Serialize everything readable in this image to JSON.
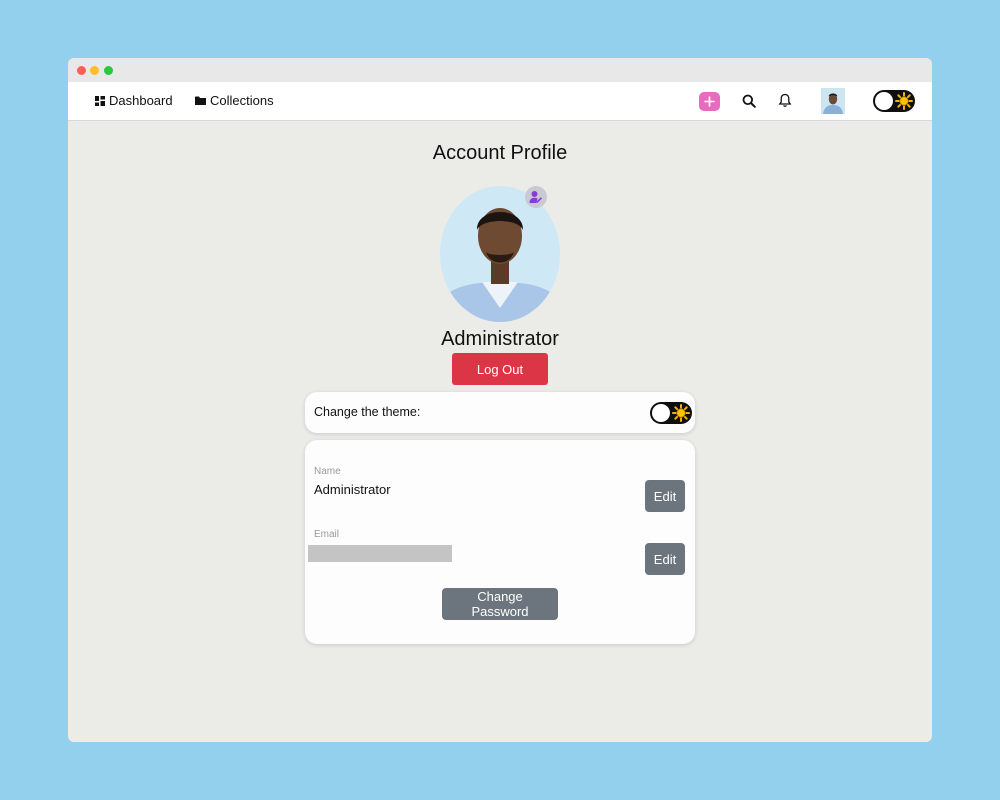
{
  "nav": {
    "dashboard_label": "Dashboard",
    "collections_label": "Collections",
    "add_icon": "plus-icon",
    "search_icon": "search-icon",
    "notification_icon": "bell-icon",
    "theme_icon": "sun-icon"
  },
  "profile": {
    "title": "Account Profile",
    "username": "Administrator",
    "logout_label": "Log Out"
  },
  "theme": {
    "label": "Change the theme:"
  },
  "fields": {
    "name_label": "Name",
    "name_value": "Administrator",
    "email_label": "Email",
    "email_value": "",
    "edit_label": "Edit",
    "change_password_label": "Change Password"
  },
  "colors": {
    "background": "#92d0ee",
    "logout": "#dc3545",
    "secondary_button": "#6c757d",
    "add_button": "#e86bbf"
  }
}
